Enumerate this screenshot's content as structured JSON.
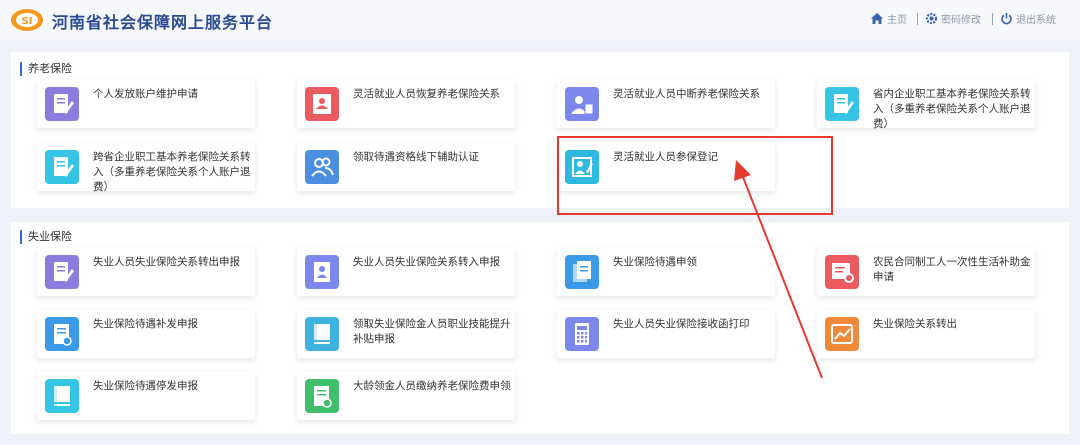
{
  "header": {
    "title": "河南省社会保障网上服务平台",
    "nav": [
      {
        "label": "主页",
        "icon": "home-icon"
      },
      {
        "label": "密码修改",
        "icon": "gear-icon"
      },
      {
        "label": "退出系统",
        "icon": "power-icon"
      }
    ]
  },
  "sections": [
    {
      "title": "养老保险",
      "items": [
        {
          "label": "个人发放账户维护申请",
          "icon": "edit-document-icon",
          "color": "#8d7be0"
        },
        {
          "label": "灵活就业人员恢复养老保险关系",
          "icon": "id-card-icon",
          "color": "#ea5a5f"
        },
        {
          "label": "灵活就业人员中断养老保险关系",
          "icon": "user-document-icon",
          "color": "#7b87ea"
        },
        {
          "label": "省内企业职工基本养老保险关系转入（多重养老保险关系个人账户退费）",
          "icon": "edit-document-icon",
          "color": "#35c3e6"
        },
        {
          "label": "跨省企业职工基本养老保险关系转入（多重养老保险关系个人账户退费）",
          "icon": "edit-document-icon",
          "color": "#35c3e6"
        },
        {
          "label": "领取待遇资格线下辅助认证",
          "icon": "users-icon",
          "color": "#4a8fe0"
        },
        {
          "label": "灵活就业人员参保登记",
          "icon": "register-icon",
          "color": "#30b9e0"
        }
      ]
    },
    {
      "title": "失业保险",
      "items": [
        {
          "label": "失业人员失业保险关系转出申报",
          "icon": "edit-document-icon",
          "color": "#8d7be0"
        },
        {
          "label": "失业人员失业保险关系转入申报",
          "icon": "user-document-icon",
          "color": "#7b87ea"
        },
        {
          "label": "失业保险待遇申领",
          "icon": "documents-icon",
          "color": "#3a9ae8"
        },
        {
          "label": "农民合同制工人一次性生活补助金申请",
          "icon": "search-document-icon",
          "color": "#ea5a5f"
        },
        {
          "label": "失业保险待遇补发申报",
          "icon": "document-coin-icon",
          "color": "#3a9ae8"
        },
        {
          "label": "领取失业保险金人员职业技能提升补贴申报",
          "icon": "book-icon",
          "color": "#40b2e0"
        },
        {
          "label": "失业人员失业保险接收函打印",
          "icon": "calculator-icon",
          "color": "#7b87ea"
        },
        {
          "label": "失业保险关系转出",
          "icon": "chart-icon",
          "color": "#f08a3a"
        },
        {
          "label": "失业保险待遇停发申报",
          "icon": "book-icon",
          "color": "#35c3e6"
        },
        {
          "label": "大龄领金人员缴纳养老保险费申领",
          "icon": "document-coin-icon",
          "color": "#3fbf6a"
        }
      ]
    }
  ]
}
